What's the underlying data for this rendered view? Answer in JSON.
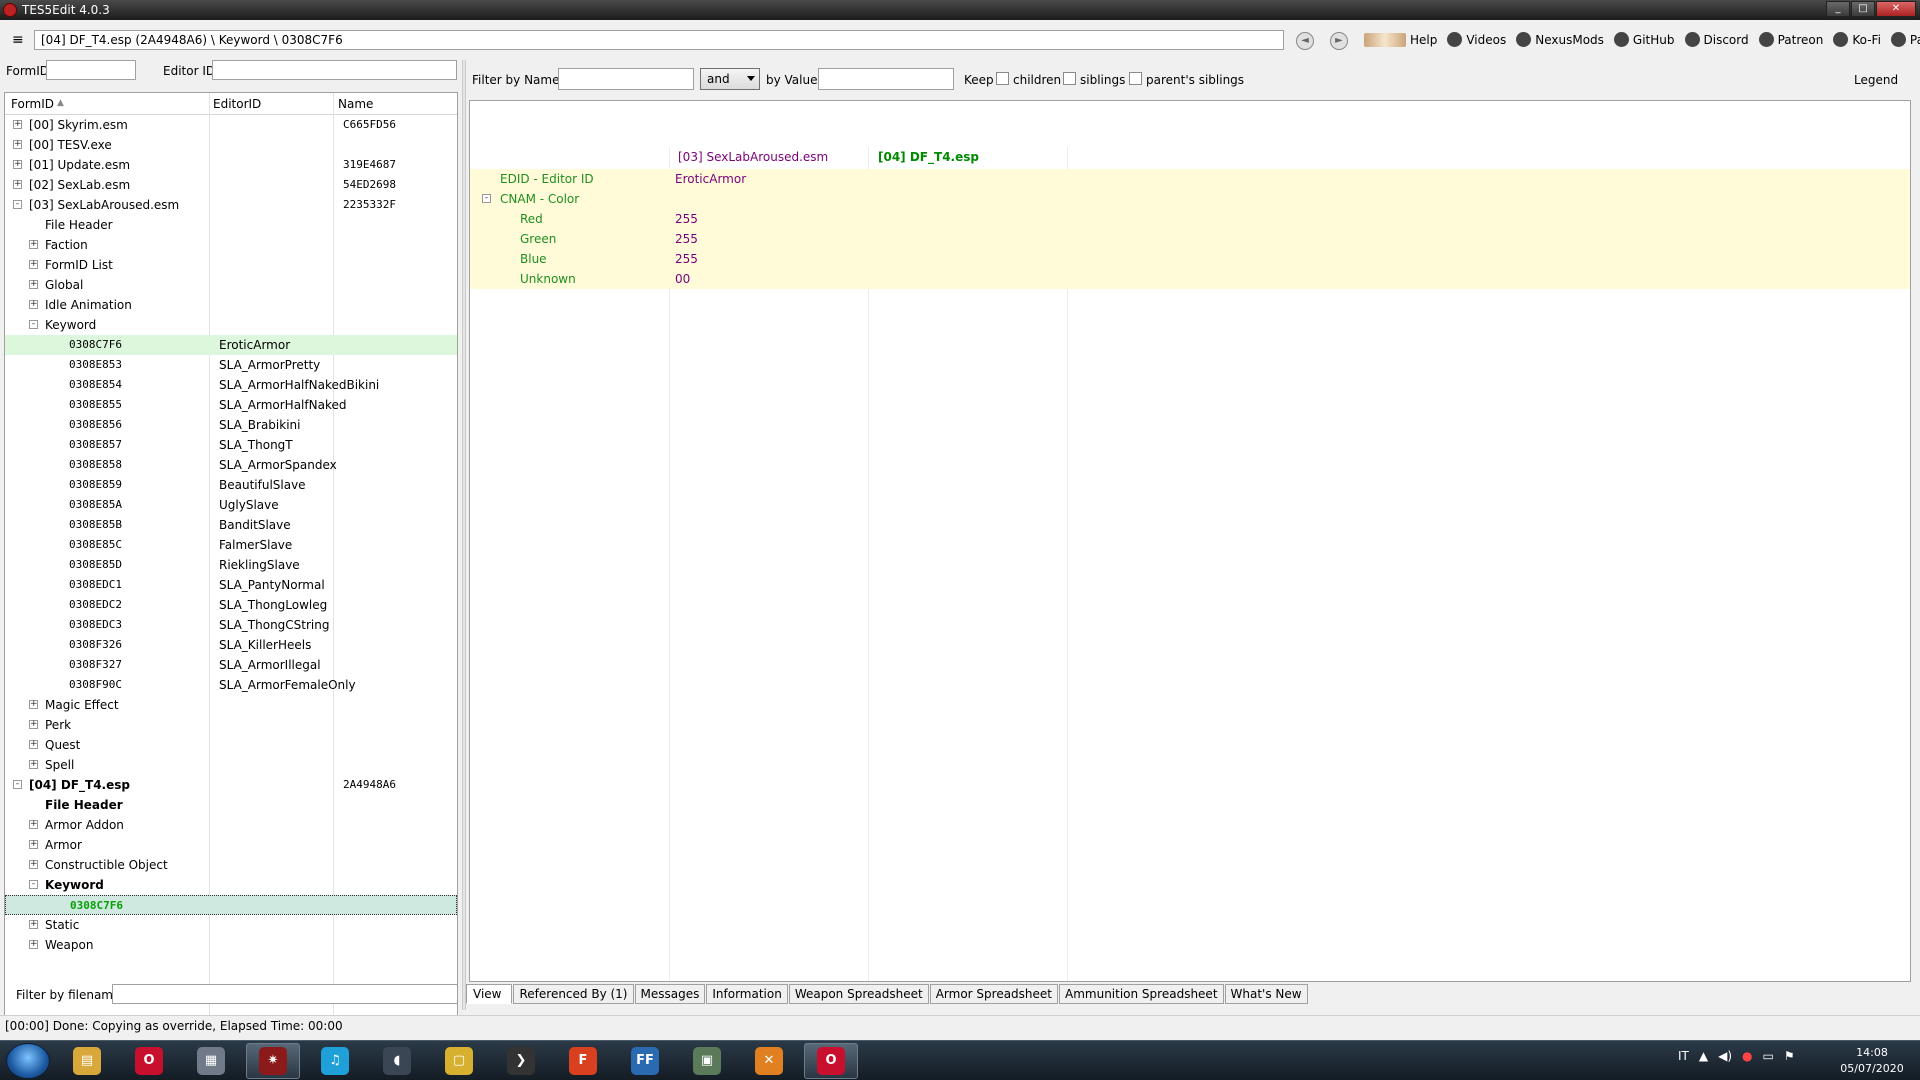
{
  "window": {
    "title": "TES5Edit 4.0.3",
    "minimize": "_",
    "maximize": "□",
    "close": "✕"
  },
  "toolbar": {
    "menu_glyph": "≡",
    "path": "[04] DF_T4.esp (2A4948A6) \\ Keyword \\ 0308C7F6",
    "back_glyph": "◄",
    "forward_glyph": "►",
    "links": [
      {
        "label": "Help",
        "icon": "book-icon"
      },
      {
        "label": "Videos",
        "icon": "film-icon"
      },
      {
        "label": "NexusMods",
        "icon": "nexus-icon"
      },
      {
        "label": "GitHub",
        "icon": "github-icon"
      },
      {
        "label": "Discord",
        "icon": "discord-icon"
      },
      {
        "label": "Patreon",
        "icon": "patreon-icon"
      },
      {
        "label": "Ko-Fi",
        "icon": "kofi-icon"
      },
      {
        "label": "PayPal",
        "icon": "paypal-icon"
      }
    ]
  },
  "left": {
    "formid_label": "FormID",
    "formid_value": "",
    "editorid_label": "Editor ID",
    "editorid_value": "",
    "columns": {
      "formid": "FormID",
      "sort_glyph": "▲",
      "editorid": "EditorID",
      "name": "Name"
    },
    "rows": [
      {
        "indent": 0,
        "exp": "+",
        "id": "[00] Skyrim.esm",
        "editorid": "",
        "name": "C665FD56",
        "bold": false,
        "mono": false
      },
      {
        "indent": 0,
        "exp": "+",
        "id": "[00] TESV.exe",
        "editorid": "",
        "name": "",
        "bold": false,
        "mono": false
      },
      {
        "indent": 0,
        "exp": "+",
        "id": "[01] Update.esm",
        "editorid": "",
        "name": "319E4687",
        "bold": false,
        "mono": false
      },
      {
        "indent": 0,
        "exp": "+",
        "id": "[02] SexLab.esm",
        "editorid": "",
        "name": "54ED2698",
        "bold": false,
        "mono": false
      },
      {
        "indent": 0,
        "exp": "-",
        "id": "[03] SexLabAroused.esm",
        "editorid": "",
        "name": "2235332F",
        "bold": false,
        "mono": false
      },
      {
        "indent": 1,
        "exp": "",
        "id": "File Header",
        "editorid": "",
        "name": "",
        "bold": false,
        "mono": false
      },
      {
        "indent": 1,
        "exp": "+",
        "id": "Faction",
        "editorid": "",
        "name": "",
        "bold": false,
        "mono": false
      },
      {
        "indent": 1,
        "exp": "+",
        "id": "FormID List",
        "editorid": "",
        "name": "",
        "bold": false,
        "mono": false
      },
      {
        "indent": 1,
        "exp": "+",
        "id": "Global",
        "editorid": "",
        "name": "",
        "bold": false,
        "mono": false
      },
      {
        "indent": 1,
        "exp": "+",
        "id": "Idle Animation",
        "editorid": "",
        "name": "",
        "bold": false,
        "mono": false
      },
      {
        "indent": 1,
        "exp": "-",
        "id": "Keyword",
        "editorid": "",
        "name": "",
        "bold": false,
        "mono": false
      },
      {
        "indent": 2,
        "exp": "",
        "id": "0308C7F6",
        "editorid": "EroticArmor",
        "name": "",
        "bold": false,
        "mono": true,
        "state": "sel-light"
      },
      {
        "indent": 2,
        "exp": "",
        "id": "0308E853",
        "editorid": "SLA_ArmorPretty",
        "name": "",
        "bold": false,
        "mono": true
      },
      {
        "indent": 2,
        "exp": "",
        "id": "0308E854",
        "editorid": "SLA_ArmorHalfNakedBikini",
        "name": "",
        "bold": false,
        "mono": true
      },
      {
        "indent": 2,
        "exp": "",
        "id": "0308E855",
        "editorid": "SLA_ArmorHalfNaked",
        "name": "",
        "bold": false,
        "mono": true
      },
      {
        "indent": 2,
        "exp": "",
        "id": "0308E856",
        "editorid": "SLA_Brabikini",
        "name": "",
        "bold": false,
        "mono": true
      },
      {
        "indent": 2,
        "exp": "",
        "id": "0308E857",
        "editorid": "SLA_ThongT",
        "name": "",
        "bold": false,
        "mono": true
      },
      {
        "indent": 2,
        "exp": "",
        "id": "0308E858",
        "editorid": "SLA_ArmorSpandex",
        "name": "",
        "bold": false,
        "mono": true
      },
      {
        "indent": 2,
        "exp": "",
        "id": "0308E859",
        "editorid": "BeautifulSlave",
        "name": "",
        "bold": false,
        "mono": true
      },
      {
        "indent": 2,
        "exp": "",
        "id": "0308E85A",
        "editorid": "UglySlave",
        "name": "",
        "bold": false,
        "mono": true
      },
      {
        "indent": 2,
        "exp": "",
        "id": "0308E85B",
        "editorid": "BanditSlave",
        "name": "",
        "bold": false,
        "mono": true
      },
      {
        "indent": 2,
        "exp": "",
        "id": "0308E85C",
        "editorid": "FalmerSlave",
        "name": "",
        "bold": false,
        "mono": true
      },
      {
        "indent": 2,
        "exp": "",
        "id": "0308E85D",
        "editorid": "RieklingSlave",
        "name": "",
        "bold": false,
        "mono": true
      },
      {
        "indent": 2,
        "exp": "",
        "id": "0308EDC1",
        "editorid": "SLA_PantyNormal",
        "name": "",
        "bold": false,
        "mono": true
      },
      {
        "indent": 2,
        "exp": "",
        "id": "0308EDC2",
        "editorid": "SLA_ThongLowleg",
        "name": "",
        "bold": false,
        "mono": true
      },
      {
        "indent": 2,
        "exp": "",
        "id": "0308EDC3",
        "editorid": "SLA_ThongCString",
        "name": "",
        "bold": false,
        "mono": true
      },
      {
        "indent": 2,
        "exp": "",
        "id": "0308F326",
        "editorid": "SLA_KillerHeels",
        "name": "",
        "bold": false,
        "mono": true
      },
      {
        "indent": 2,
        "exp": "",
        "id": "0308F327",
        "editorid": "SLA_ArmorIllegal",
        "name": "",
        "bold": false,
        "mono": true
      },
      {
        "indent": 2,
        "exp": "",
        "id": "0308F90C",
        "editorid": "SLA_ArmorFemaleOnly",
        "name": "",
        "bold": false,
        "mono": true
      },
      {
        "indent": 1,
        "exp": "+",
        "id": "Magic Effect",
        "editorid": "",
        "name": "",
        "bold": false,
        "mono": false
      },
      {
        "indent": 1,
        "exp": "+",
        "id": "Perk",
        "editorid": "",
        "name": "",
        "bold": false,
        "mono": false
      },
      {
        "indent": 1,
        "exp": "+",
        "id": "Quest",
        "editorid": "",
        "name": "",
        "bold": false,
        "mono": false
      },
      {
        "indent": 1,
        "exp": "+",
        "id": "Spell",
        "editorid": "",
        "name": "",
        "bold": false,
        "mono": false
      },
      {
        "indent": 0,
        "exp": "-",
        "id": "[04] DF_T4.esp",
        "editorid": "",
        "name": "2A4948A6",
        "bold": true,
        "mono": false
      },
      {
        "indent": 1,
        "exp": "",
        "id": "File Header",
        "editorid": "",
        "name": "",
        "bold": true,
        "mono": false
      },
      {
        "indent": 1,
        "exp": "+",
        "id": "Armor Addon",
        "editorid": "",
        "name": "",
        "bold": false,
        "mono": false
      },
      {
        "indent": 1,
        "exp": "+",
        "id": "Armor",
        "editorid": "",
        "name": "",
        "bold": false,
        "mono": false
      },
      {
        "indent": 1,
        "exp": "+",
        "id": "Constructible Object",
        "editorid": "",
        "name": "",
        "bold": false,
        "mono": false
      },
      {
        "indent": 1,
        "exp": "-",
        "id": "Keyword",
        "editorid": "",
        "name": "",
        "bold": true,
        "mono": false
      },
      {
        "indent": 2,
        "exp": "",
        "id": "0308C7F6",
        "editorid": "",
        "name": "",
        "bold": true,
        "mono": true,
        "green": true,
        "state": "sel-main"
      },
      {
        "indent": 1,
        "exp": "+",
        "id": "Static",
        "editorid": "",
        "name": "",
        "bold": false,
        "mono": false
      },
      {
        "indent": 1,
        "exp": "+",
        "id": "Weapon",
        "editorid": "",
        "name": "",
        "bold": false,
        "mono": false
      }
    ],
    "filename_label": "Filter by filename:",
    "filename_value": ""
  },
  "right": {
    "filter_name_label": "Filter by Name:",
    "filter_name_value": "",
    "op_value": "and",
    "filter_value_label": "by Value:",
    "filter_value_value": "",
    "keep_label": "Keep",
    "children_label": "children",
    "siblings_label": "siblings",
    "parents_siblings_label": "parent's siblings",
    "legend_label": "Legend",
    "col_header_1": "[03] SexLabAroused.esm",
    "col_header_2": "[04] DF_T4.esp",
    "rows": [
      {
        "indent": 0,
        "exp": "",
        "name": "EDID - Editor ID",
        "value": "EroticArmor"
      },
      {
        "indent": 0,
        "exp": "-",
        "name": "CNAM - Color",
        "value": ""
      },
      {
        "indent": 1,
        "exp": "",
        "name": "Red",
        "value": "255"
      },
      {
        "indent": 1,
        "exp": "",
        "name": "Green",
        "value": "255"
      },
      {
        "indent": 1,
        "exp": "",
        "name": "Blue",
        "value": "255"
      },
      {
        "indent": 1,
        "exp": "",
        "name": "Unknown",
        "value": "00"
      }
    ],
    "tabs": [
      "View",
      "Referenced By (1)",
      "Messages",
      "Information",
      "Weapon Spreadsheet",
      "Armor Spreadsheet",
      "Ammunition Spreadsheet",
      "What's New"
    ]
  },
  "status": "[00:00] Done: Copying as override, Elapsed Time: 00:00",
  "taskbar": {
    "apps": [
      {
        "name": "explorer",
        "color": "#d8a83a",
        "glyph": "▤"
      },
      {
        "name": "opera",
        "color": "#c8102e",
        "glyph": "O"
      },
      {
        "name": "media",
        "color": "#707a88",
        "glyph": "▦"
      },
      {
        "name": "tes5edit",
        "color": "#8b1a1a",
        "glyph": "✷",
        "active": true
      },
      {
        "name": "music",
        "color": "#1fa0d8",
        "glyph": "♫"
      },
      {
        "name": "audio",
        "color": "#3a4654",
        "glyph": "◖"
      },
      {
        "name": "folder",
        "color": "#d8b030",
        "glyph": "▢"
      },
      {
        "name": "script",
        "color": "#333333",
        "glyph": "❯"
      },
      {
        "name": "foobar",
        "color": "#d84020",
        "glyph": "F"
      },
      {
        "name": "ffdec",
        "color": "#2a6ab0",
        "glyph": "FF"
      },
      {
        "name": "window",
        "color": "#5a7a5a",
        "glyph": "▣"
      },
      {
        "name": "puzzle",
        "color": "#e08020",
        "glyph": "✕"
      },
      {
        "name": "opera2",
        "color": "#c8102e",
        "glyph": "O",
        "active": true
      }
    ],
    "lang": "IT",
    "time": "14:08",
    "date": "05/07/2020"
  }
}
